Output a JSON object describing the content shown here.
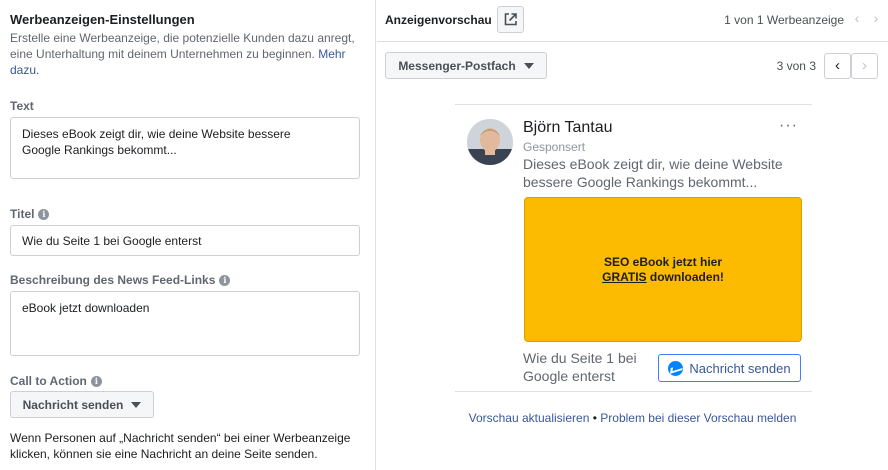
{
  "settings": {
    "title": "Werbeanzeigen-Einstellungen",
    "description": "Erstelle eine Werbeanzeige, die potenzielle Kunden dazu anregt, eine Unterhaltung mit deinem Unternehmen zu beginnen.",
    "more_link": "Mehr dazu.",
    "text_label": "Text",
    "text_value": "Dieses eBook zeigt dir, wie deine Website bessere\nGoogle Rankings bekommt...",
    "titel_label": "Titel",
    "titel_value": "Wie du Seite 1 bei Google enterst",
    "desc_label": "Beschreibung des News Feed-Links",
    "desc_value": "eBook jetzt downloaden",
    "cta_label": "Call to Action",
    "cta_value": "Nachricht senden",
    "cta_note": "Wenn Personen auf „Nachricht senden“ bei einer Werbeanzeige klicken, können sie eine Nachricht an deine Seite senden."
  },
  "preview": {
    "title": "Anzeigenvorschau",
    "ad_count": "1 von 1 Werbeanzeige",
    "placement": "Messenger-Postfach",
    "position": "3 von 3",
    "ad": {
      "page_name": "Björn Tantau",
      "sponsored": "Gesponsert",
      "more": "···",
      "text": "Dieses eBook zeigt dir, wie deine Website bessere Google Rankings bekommt...",
      "image_line1": "SEO eBook jetzt hier",
      "image_line2_underlined": "GRATIS",
      "image_line2_rest": " downloaden!",
      "headline": "Wie du Seite 1 bei Google enterst",
      "button": "Nachricht senden"
    },
    "refresh_link": "Vorschau aktualisieren",
    "separator": "•",
    "report_link": "Problem bei dieser Vorschau melden"
  },
  "colors": {
    "link": "#385898",
    "ad_background": "#fdbb00",
    "messenger": "#0084ff"
  }
}
